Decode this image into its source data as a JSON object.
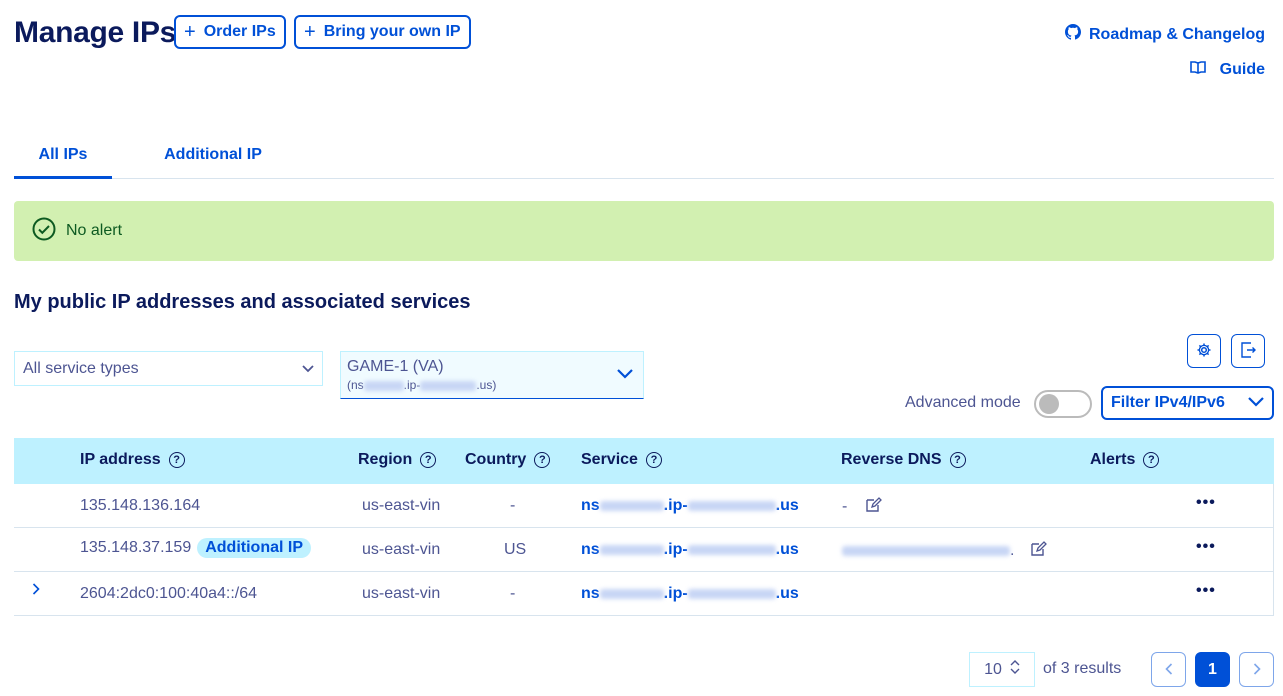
{
  "header": {
    "title": "Manage IPs",
    "order_ips_label": "Order IPs",
    "byoip_label": "Bring your own IP",
    "roadmap_label": "Roadmap & Changelog",
    "guide_label": "Guide"
  },
  "tabs": [
    {
      "label": "All IPs",
      "active": true
    },
    {
      "label": "Additional IP",
      "active": false
    }
  ],
  "alert": {
    "text": "No alert"
  },
  "section": {
    "title": "My public IP addresses and associated services"
  },
  "filters": {
    "service_types": "All service types",
    "service_main": "GAME-1 (VA)",
    "service_sub_prefix": "(ns",
    "service_sub_mid": ".ip-",
    "service_sub_suffix": ".us)",
    "advanced_mode_label": "Advanced mode",
    "advanced_mode_on": false,
    "filter_ip_label": "Filter IPv4/IPv6"
  },
  "table": {
    "headers": [
      "IP address",
      "Region",
      "Country",
      "Service",
      "Reverse DNS",
      "Alerts"
    ],
    "rows": [
      {
        "ip": "135.148.136.164",
        "badge": "",
        "region": "us-east-vin",
        "country": "-",
        "service_prefix": "ns",
        "service_mid": ".ip-",
        "service_suffix": ".us",
        "reverse_dns": "-",
        "expandable": false
      },
      {
        "ip": "135.148.37.159",
        "badge": "Additional IP",
        "region": "us-east-vin",
        "country": "US",
        "service_prefix": "ns",
        "service_mid": ".ip-",
        "service_suffix": ".us",
        "reverse_dns": ".",
        "expandable": false
      },
      {
        "ip": "2604:2dc0:100:40a4::/64",
        "badge": "",
        "region": "us-east-vin",
        "country": "-",
        "service_prefix": "ns",
        "service_mid": ".ip-",
        "service_suffix": ".us",
        "reverse_dns": "",
        "expandable": true
      }
    ]
  },
  "pagination": {
    "page_size": "10",
    "results_text": "of 3 results",
    "current_page": "1"
  },
  "colors": {
    "accent": "#0050d7",
    "title": "#0b1a5c",
    "header_bg": "#bef1ff",
    "alert_bg": "#d2f0b1"
  }
}
